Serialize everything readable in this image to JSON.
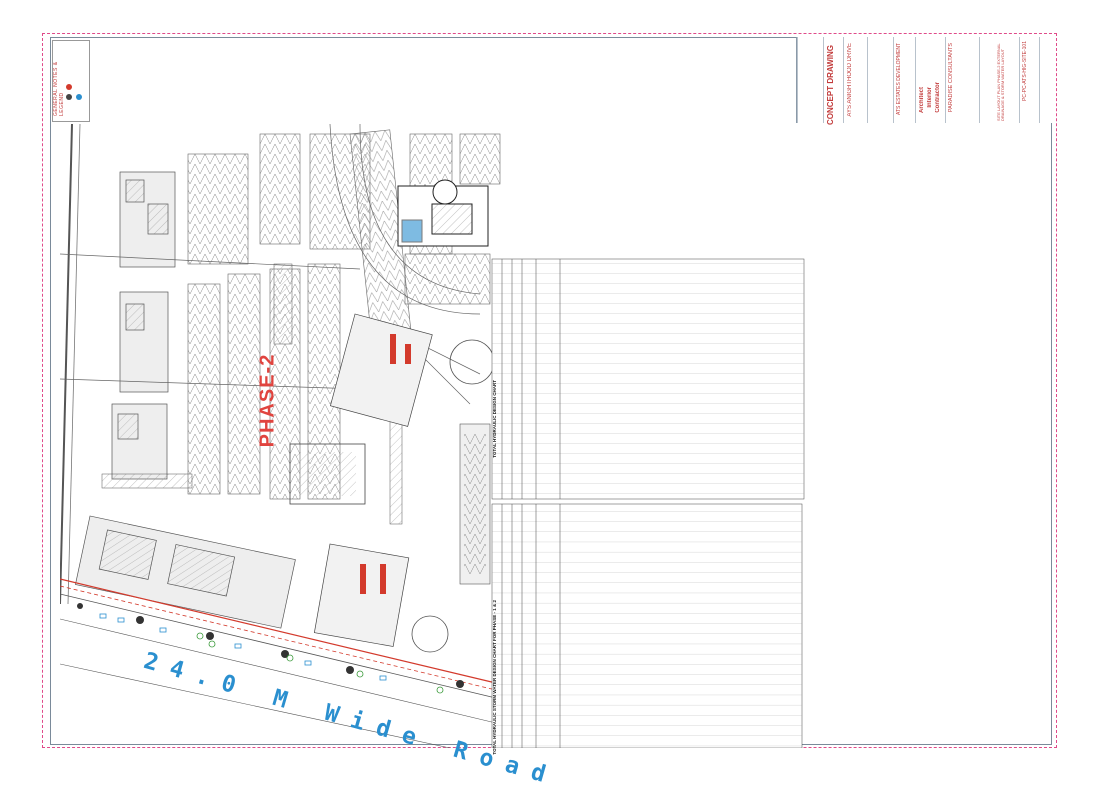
{
  "drawing": {
    "road_label": "24.0 M Wide Road",
    "phase_label": "PHASE-2",
    "legend_title": "GENERAL NOTES & LEGEND"
  },
  "title_block": {
    "drawing_status": "CONCEPT DRAWING",
    "project_name": "AYS ANIGHTHOOD DRIVE",
    "client": "ATS ESTATES DEVELOPMENT",
    "consultant": "PARADISE CONSULTANTS",
    "architect": "Architect",
    "interior": "Interior",
    "contractor": "Contractor",
    "sheet_title": "SITE LAYOUT PLAN PHASE-2 EXTERNAL DRAINAGE & STORM WATER LAYOUT",
    "drawing_no": "PC-PC-ATS-HIG-SITE-101"
  },
  "tables": {
    "left_title": "TOTAL HYDRAULIC STORM WATER DESIGN CHART FOR PHASE - 1 & 2",
    "right_title": "TOTAL HYDRAULIC DESIGN CHART",
    "left_row_count": 54,
    "right_row_count": 36
  },
  "colors": {
    "border_dash": "#e04a8a",
    "road_text": "#2a8fcf",
    "phase_text": "#e0443f",
    "site_lines": "#444444",
    "hatch": "#9a9a9a",
    "drain_red": "#d33a2c"
  }
}
